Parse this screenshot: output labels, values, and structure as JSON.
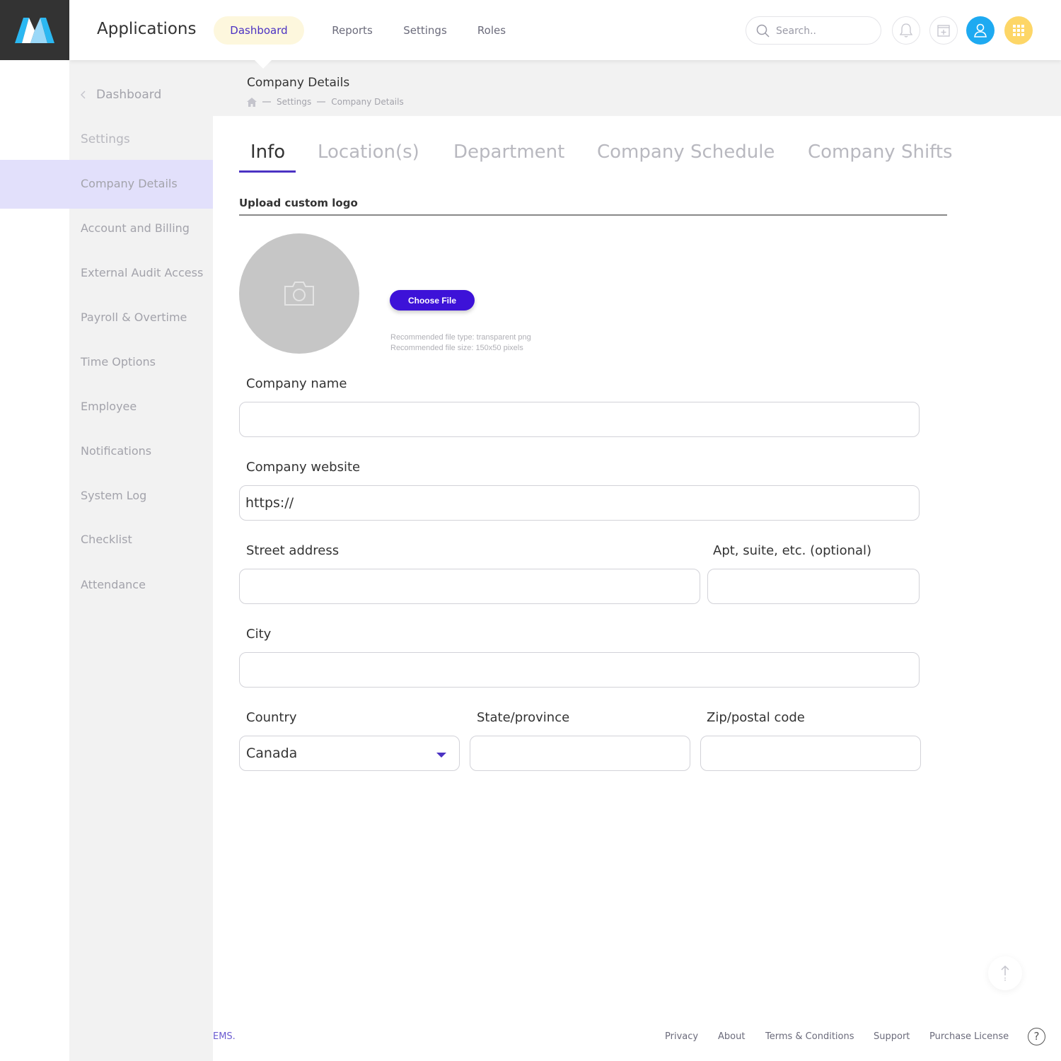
{
  "header": {
    "app_title": "Applications",
    "nav": [
      "Dashboard",
      "Reports",
      "Settings",
      "Roles"
    ],
    "active_nav": "Dashboard",
    "search_placeholder": "Search..",
    "accent_color": "#4b32c3",
    "user_button_color": "#1eaaf1",
    "apps_button_color": "#fdd667"
  },
  "sidebar": {
    "back_label": "Dashboard",
    "section_label": "Settings",
    "items": [
      "Company Details",
      "Account and Billing",
      "External Audit Access",
      "Payroll & Overtime",
      "Time Options",
      "Employee",
      "Notifications",
      "System Log",
      "Checklist",
      "Attendance"
    ],
    "active_item": "Company Details"
  },
  "page": {
    "title": "Company Details",
    "breadcrumb": [
      "Settings",
      "Company Details"
    ]
  },
  "tabs": [
    "Info",
    "Location(s)",
    "Department",
    "Company Schedule",
    "Company Shifts"
  ],
  "active_tab": "Info",
  "logo_upload": {
    "title": "Upload custom logo",
    "button": "Choose File",
    "hint_type": "Recommended file type: transparent png",
    "hint_size": "Recommended file size: 150x50 pixels"
  },
  "form": {
    "company_name_label": "Company name",
    "company_name_value": "",
    "company_website_label": "Company website",
    "company_website_value": "https://",
    "street_label": "Street address",
    "apt_label": "Apt, suite, etc. (optional)",
    "city_label": "City",
    "country_label": "Country",
    "country_value": "Canada",
    "state_label": "State/province",
    "zip_label": "Zip/postal code"
  },
  "footer": {
    "left_text": "EMS.",
    "links": [
      "Privacy",
      "About",
      "Terms & Conditions",
      "Support",
      "Purchase License"
    ],
    "help": "?"
  }
}
